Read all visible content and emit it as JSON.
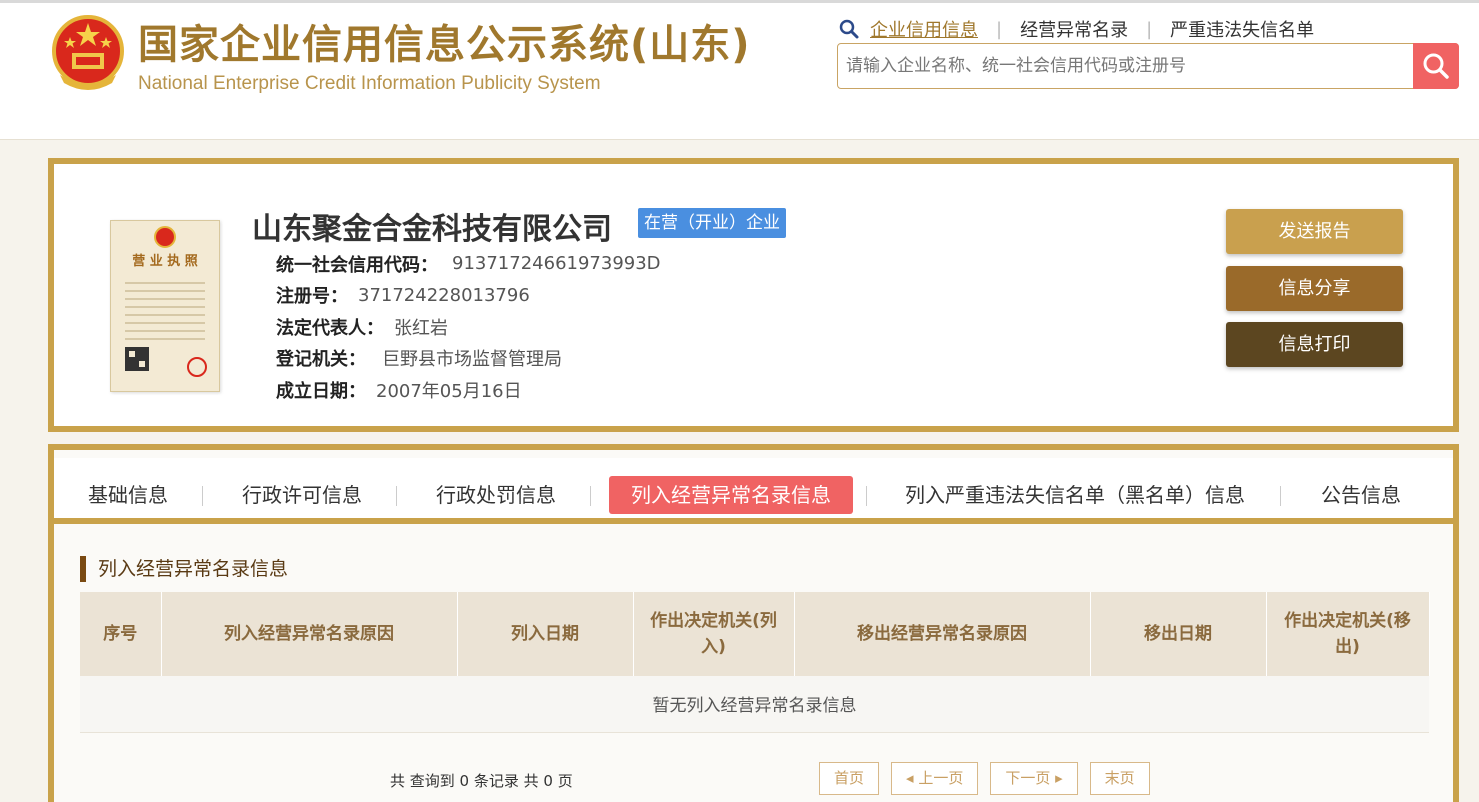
{
  "header": {
    "title": "国家企业信用信息公示系统(山东)",
    "subtitle": "National Enterprise Credit Information Publicity System",
    "nav": [
      "企业信用信息",
      "经营异常名录",
      "严重违法失信名单"
    ],
    "search_placeholder": "请输入企业名称、统一社会信用代码或注册号"
  },
  "company": {
    "name": "山东聚金合金科技有限公司",
    "status": "在营（开业）企业",
    "license_heading": "营 业 执 照",
    "fields": [
      {
        "key": "统一社会信用代码：",
        "value": "91371724661973993D"
      },
      {
        "key": "注册号：",
        "value": "371724228013796"
      },
      {
        "key": "法定代表人：",
        "value": "张红岩"
      },
      {
        "key": "登记机关：",
        "value": "巨野县市场监督管理局"
      },
      {
        "key": "成立日期：",
        "value": "2007年05月16日"
      }
    ],
    "buttons": {
      "report": "发送报告",
      "share": "信息分享",
      "print": "信息打印"
    }
  },
  "tabs": [
    "基础信息",
    "行政许可信息",
    "行政处罚信息",
    "列入经营异常名录信息",
    "列入严重违法失信名单（黑名单）信息",
    "公告信息"
  ],
  "active_tab": "列入经营异常名录信息",
  "section": {
    "title": "列入经营异常名录信息",
    "columns": [
      "序号",
      "列入经营异常名录原因",
      "列入日期",
      "作出决定机关(列入)",
      "移出经营异常名录原因",
      "移出日期",
      "作出决定机关(移出)"
    ],
    "empty_text": "暂无列入经营异常名录信息",
    "count_text": "共 查询到 0 条记录 共 0 页",
    "pager": [
      "首页",
      "上一页",
      "下一页",
      "末页"
    ]
  },
  "colors": {
    "gold": "#c9a24a",
    "accent_red": "#f06363",
    "badge_blue": "#4a8fe0"
  }
}
